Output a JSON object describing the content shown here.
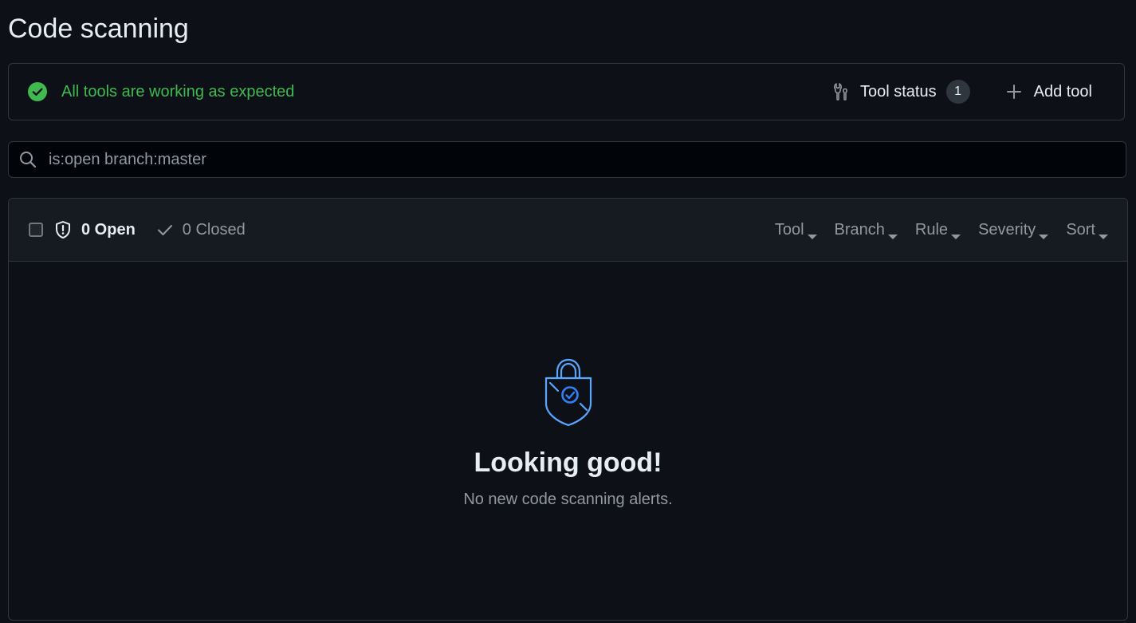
{
  "page": {
    "title": "Code scanning"
  },
  "status": {
    "message": "All tools are working as expected",
    "tool_status_label": "Tool status",
    "tool_status_count": "1",
    "add_tool_label": "Add tool"
  },
  "search": {
    "value": "is:open branch:master"
  },
  "alerts": {
    "open_label": "0 Open",
    "closed_label": "0 Closed",
    "filters": [
      "Tool",
      "Branch",
      "Rule",
      "Severity",
      "Sort"
    ]
  },
  "empty_state": {
    "title": "Looking good!",
    "subtitle": "No new code scanning alerts."
  },
  "colors": {
    "background": "#0d1117",
    "success": "#3fb950",
    "accent": "#58a6ff",
    "muted": "#9198a1",
    "border": "#30363d"
  },
  "icons": {
    "status": "check-circle-icon",
    "tool_status": "tools-icon",
    "add_tool": "plus-icon",
    "search": "search-icon",
    "open": "shield-icon",
    "closed": "check-icon",
    "filter_caret": "caret-down-icon",
    "empty_state": "shield-lock-check-icon"
  }
}
